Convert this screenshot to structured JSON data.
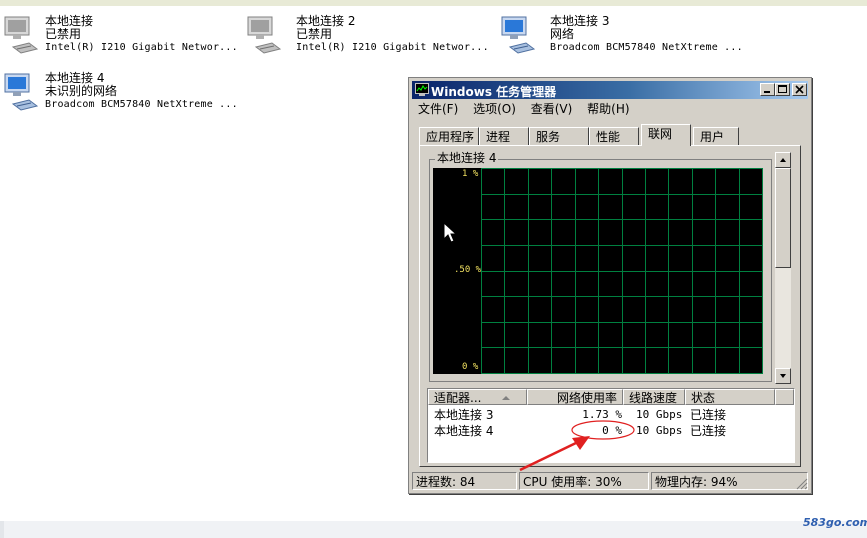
{
  "connections": [
    {
      "name": "本地连接",
      "status": "已禁用",
      "device": "Intel(R) I210 Gigabit Networ...",
      "icon": "network-disabled-icon"
    },
    {
      "name": "本地连接 2",
      "status": "已禁用",
      "device": "Intel(R) I210 Gigabit Networ...",
      "icon": "network-disabled-icon"
    },
    {
      "name": "本地连接 3",
      "status": "网络",
      "device": "Broadcom BCM57840 NetXtreme ...",
      "icon": "network-connected-icon"
    },
    {
      "name": "本地连接 4",
      "status": "未识别的网络",
      "device": "Broadcom BCM57840 NetXtreme ...",
      "icon": "network-connected-icon"
    }
  ],
  "taskmgr": {
    "title": "Windows 任务管理器",
    "menu": [
      "文件(F)",
      "选项(O)",
      "查看(V)",
      "帮助(H)"
    ],
    "tabs": [
      "应用程序",
      "进程",
      "服务",
      "性能",
      "联网",
      "用户"
    ],
    "active_tab": "联网",
    "group_title": "本地连接 4",
    "graph": {
      "y_top": "1 %",
      "y_mid": ".50 %",
      "y_bottom": "0 %",
      "grid_color": "#008040"
    },
    "table": {
      "headers": [
        "适配器...",
        "网络使用率",
        "线路速度",
        "状态"
      ],
      "rows": [
        {
          "adapter": "本地连接 3",
          "usage": "1.73 %",
          "speed": "10 Gbps",
          "state": "已连接"
        },
        {
          "adapter": "本地连接 4",
          "usage": "0 %",
          "speed": "10 Gbps",
          "state": "已连接"
        }
      ]
    },
    "status": {
      "processes": "进程数: 84",
      "cpu": "CPU 使用率: 30%",
      "memory": "物理内存: 94%"
    }
  },
  "colors": {
    "annotation": "#e02020",
    "title_gradient_start": "#0a246a",
    "title_gradient_end": "#a6caf0",
    "graph_bg": "#000000",
    "y_label": "#f0e060"
  },
  "watermark": "583go.com"
}
